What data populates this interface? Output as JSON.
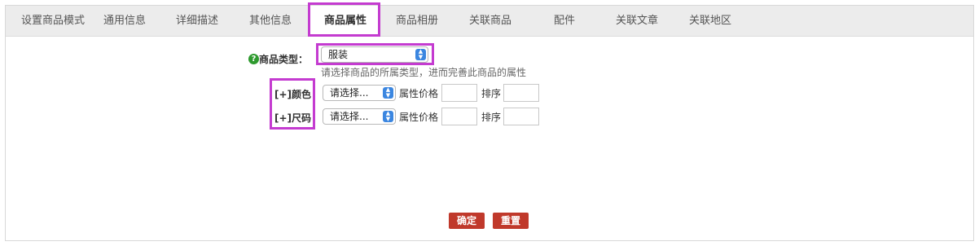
{
  "tabs": [
    {
      "label": "设置商品模式"
    },
    {
      "label": "通用信息"
    },
    {
      "label": "详细描述"
    },
    {
      "label": "其他信息"
    },
    {
      "label": "商品属性",
      "active": true
    },
    {
      "label": "商品相册"
    },
    {
      "label": "关联商品"
    },
    {
      "label": "配件"
    },
    {
      "label": "关联文章"
    },
    {
      "label": "关联地区"
    }
  ],
  "goods_type": {
    "label": "商品类型：",
    "selected": "服装",
    "hint": "请选择商品的所属类型，进而完善此商品的属性"
  },
  "attributes": [
    {
      "label": "[+]颜色",
      "select": "请选择...",
      "price_label": "属性价格",
      "sort_label": "排序"
    },
    {
      "label": "[+]尺码",
      "select": "请选择...",
      "price_label": "属性价格",
      "sort_label": "排序"
    }
  ],
  "buttons": {
    "confirm": "确定",
    "reset": "重置"
  },
  "colors": {
    "highlight": "#c43bd0",
    "button": "#c0392b",
    "help_icon": "#2e9a2e"
  }
}
